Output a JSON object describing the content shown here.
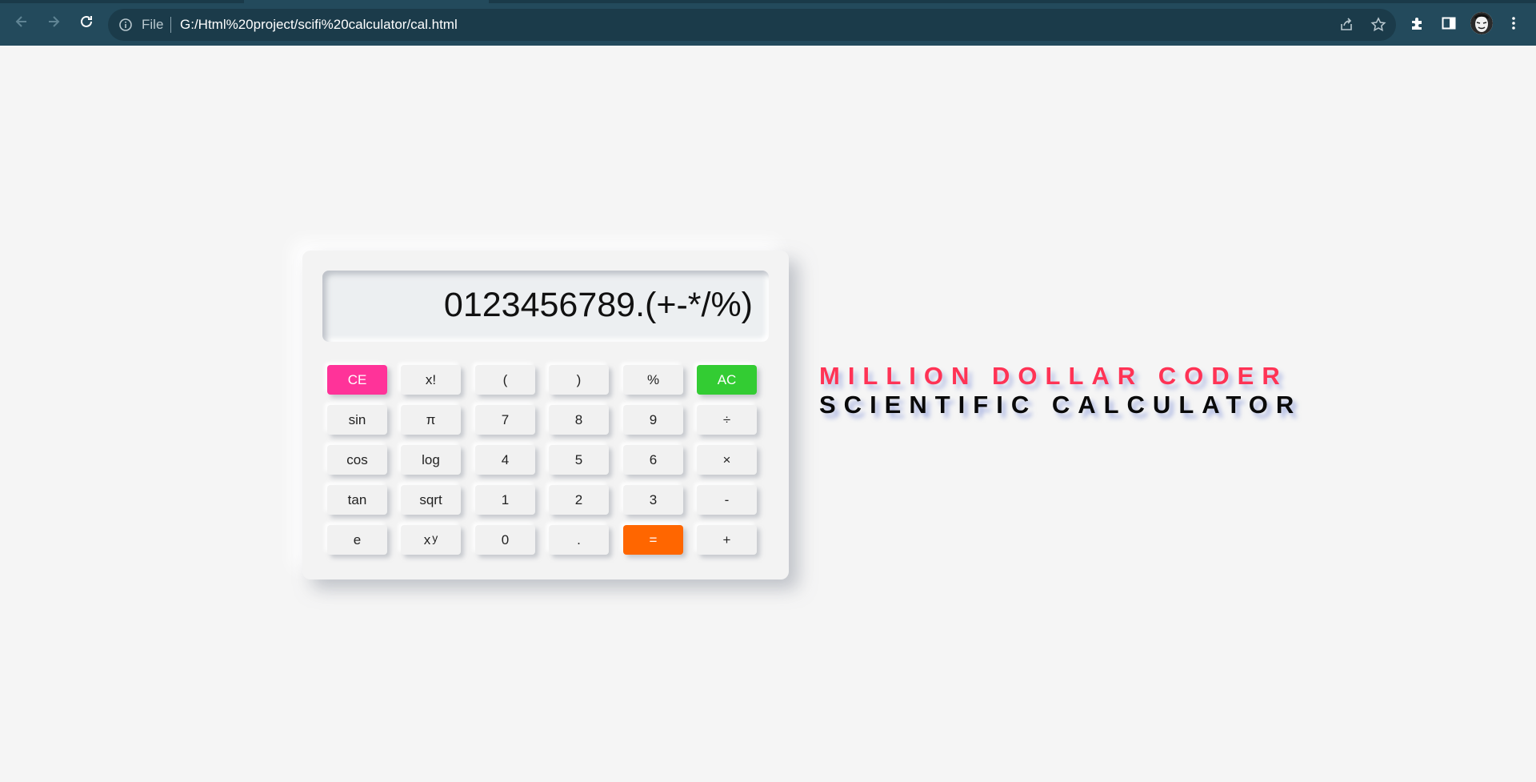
{
  "browser": {
    "address_bar": {
      "scheme_label": "File",
      "url": "G:/Html%20project/scifi%20calculator/cal.html"
    },
    "icons": {
      "back": "arrow-left-icon",
      "forward": "arrow-right-icon",
      "reload": "reload-icon",
      "info": "info-icon",
      "share": "share-icon",
      "bookmark": "star-icon",
      "extensions": "puzzle-icon",
      "side_panel": "side-panel-icon",
      "profile": "avatar",
      "menu": "kebab-menu-icon"
    },
    "colors": {
      "frame": "#234a5c",
      "omnibox": "#1b3b4a"
    }
  },
  "calculator": {
    "display": "0123456789.(+-*/%)",
    "keys": [
      [
        "CE",
        "x!",
        "(",
        ")",
        "%",
        "AC"
      ],
      [
        "sin",
        "π",
        "7",
        "8",
        "9",
        "÷"
      ],
      [
        "cos",
        "log",
        "4",
        "5",
        "6",
        "×"
      ],
      [
        "tan",
        "sqrt",
        "1",
        "2",
        "3",
        "-"
      ],
      [
        "e",
        "x",
        "0",
        ".",
        "=",
        "+"
      ]
    ],
    "power_key_sup": "y",
    "colors": {
      "clear_entry": "#ff3399",
      "all_clear": "#33cc33",
      "equals": "#ff6600"
    }
  },
  "heading": {
    "line1": "MILLION DOLLAR CODER",
    "line2": "SCIENTIFIC CALCULATOR",
    "colors": {
      "line1": "#ff3355",
      "line2": "#0a0a0a"
    }
  }
}
